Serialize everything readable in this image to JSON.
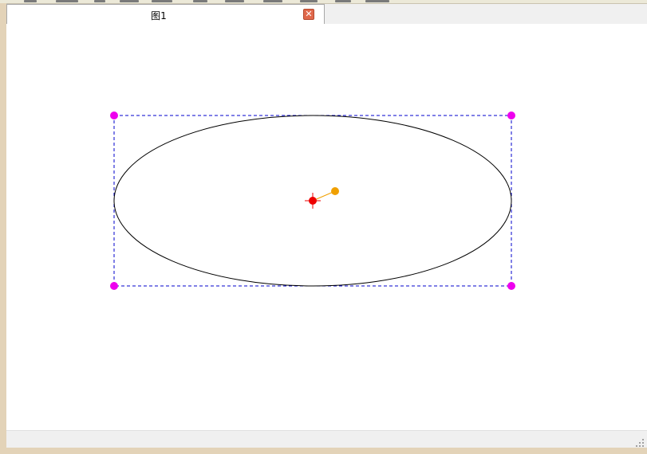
{
  "tabs": [
    {
      "label": "图1",
      "active": true
    }
  ],
  "tab_close_glyph": "✕",
  "colors": {
    "selection_box": "#0000cc",
    "handle": "#ee00ee",
    "center_marker": "#ee0000",
    "rotation_handle": "#f0a000",
    "shape_stroke": "#000000"
  },
  "icons": {
    "tab_close": "close-icon",
    "status_grip": "resize-grip-icon"
  }
}
